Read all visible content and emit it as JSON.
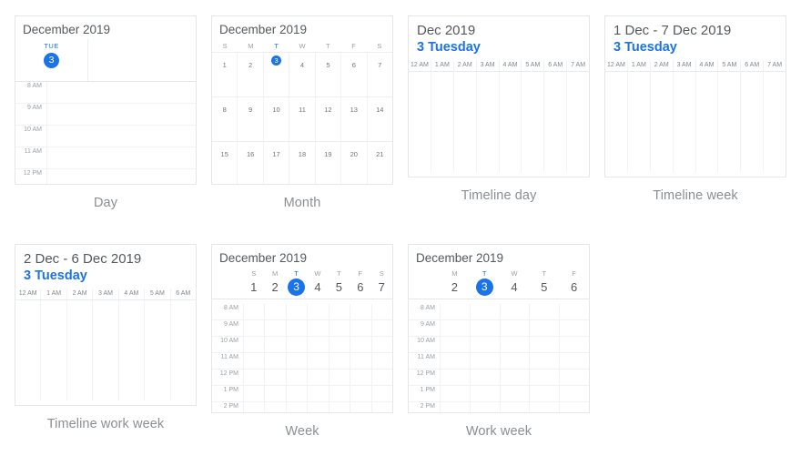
{
  "theme": {
    "accent": "#1a73e8",
    "border": "#e4e6e8",
    "grid": "#f1f2f4",
    "text": "#3c4043",
    "muted": "#9aa0a6",
    "caption": "#8a8f94",
    "background": "#ffffff"
  },
  "views": {
    "day": {
      "caption": "Day",
      "title": "December 2019",
      "day_of_week": "TUE",
      "day_number": "3",
      "hours": [
        "8 AM",
        "9 AM",
        "10 AM",
        "11 AM",
        "12 PM"
      ]
    },
    "month": {
      "caption": "Month",
      "title": "December 2019",
      "day_headers": [
        "S",
        "M",
        "T",
        "W",
        "T",
        "F",
        "S"
      ],
      "selected_day_header_index": 2,
      "weeks": [
        [
          "1",
          "2",
          "3",
          "4",
          "5",
          "6",
          "7"
        ],
        [
          "8",
          "9",
          "10",
          "11",
          "12",
          "13",
          "14"
        ],
        [
          "15",
          "16",
          "17",
          "18",
          "19",
          "20",
          "21"
        ]
      ],
      "selected_day": "3"
    },
    "timeline_day": {
      "caption": "Timeline day",
      "title": "Dec 2019",
      "subtitle": "3 Tuesday",
      "hours": [
        "12 AM",
        "1 AM",
        "2 AM",
        "3 AM",
        "4 AM",
        "5 AM",
        "6 AM",
        "7 AM"
      ]
    },
    "timeline_week": {
      "caption": "Timeline week",
      "title": "1 Dec - 7 Dec 2019",
      "subtitle": "3 Tuesday",
      "hours": [
        "12 AM",
        "1 AM",
        "2 AM",
        "3 AM",
        "4 AM",
        "5 AM",
        "6 AM",
        "7 AM"
      ]
    },
    "timeline_work_week": {
      "caption": "Timeline work week",
      "title": "2 Dec - 6 Dec 2019",
      "subtitle": "3 Tuesday",
      "hours": [
        "12 AM",
        "1 AM",
        "2 AM",
        "3 AM",
        "4 AM",
        "5 AM",
        "6 AM"
      ]
    },
    "week": {
      "caption": "Week",
      "title": "December 2019",
      "day_headers": [
        "S",
        "M",
        "T",
        "W",
        "T",
        "F",
        "S"
      ],
      "day_numbers": [
        "1",
        "2",
        "3",
        "4",
        "5",
        "6",
        "7"
      ],
      "selected_index": 2,
      "hours": [
        "8 AM",
        "9 AM",
        "10 AM",
        "11 AM",
        "12 PM",
        "1 PM",
        "2 PM"
      ]
    },
    "work_week": {
      "caption": "Work week",
      "title": "December 2019",
      "day_headers": [
        "M",
        "T",
        "W",
        "T",
        "F"
      ],
      "day_numbers": [
        "2",
        "3",
        "4",
        "5",
        "6"
      ],
      "selected_index": 1,
      "hours": [
        "8 AM",
        "9 AM",
        "10 AM",
        "11 AM",
        "12 PM",
        "1 PM",
        "2 PM"
      ]
    }
  }
}
